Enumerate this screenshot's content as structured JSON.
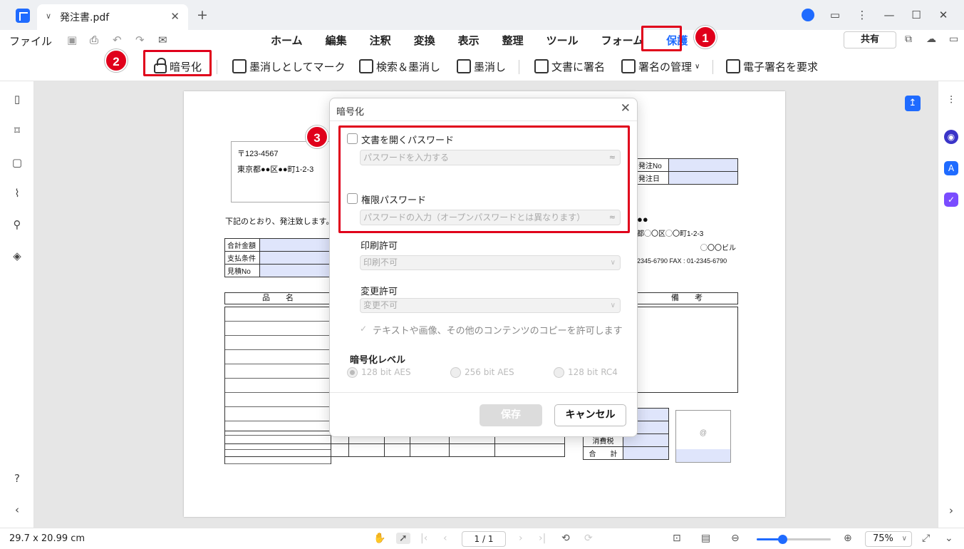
{
  "window": {
    "tab_title": "発注書.pdf",
    "new_tab": "+",
    "controls": [
      "⋮",
      "—",
      "☐",
      "✕"
    ]
  },
  "menubar": {
    "file": "ファイル",
    "items": [
      "ホーム",
      "編集",
      "注釈",
      "変換",
      "表示",
      "整理",
      "ツール",
      "フォーム",
      "保護"
    ],
    "active": "保護",
    "share": "共有"
  },
  "toolbar": {
    "encrypt": "暗号化",
    "mark_redact": "墨消しとしてマーク",
    "search_redact": "検索＆墨消し",
    "redact": "墨消し",
    "sign_doc": "文書に署名",
    "manage_sig": "署名の管理",
    "request_esig": "電子署名を要求"
  },
  "badges": [
    "1",
    "2",
    "3"
  ],
  "document": {
    "postal": "〒123-4567",
    "address": "東京都●●区●●町1-2-3",
    "intro": "下記のとおり、発注致します。",
    "left_fields": [
      "合計金額",
      "支払条件",
      "見積No"
    ],
    "right_fields": [
      "発注No",
      "発注日"
    ],
    "sender_line1": "●●",
    "sender_addr": "都◯〇区◯〇町1-2-3",
    "sender_bldg": "◯〇〇ビル",
    "sender_tel": "2345-6790  FAX : 01-2345-6790",
    "col_item": "品　　名",
    "col_note": "備　　考",
    "tax_label": "消費税",
    "total_label": "合　　計",
    "stamp": "@"
  },
  "dialog": {
    "title": "暗号化",
    "open_pw_label": "文書を開くパスワード",
    "open_pw_placeholder": "パスワードを入力する",
    "perm_pw_label": "権限パスワード",
    "perm_pw_placeholder": "パスワードの入力（オープンパスワードとは異なります）",
    "print_label": "印刷許可",
    "print_value": "印刷不可",
    "change_label": "変更許可",
    "change_value": "変更不可",
    "copy_label": "テキストや画像、その他のコンテンツのコピーを許可します",
    "level_label": "暗号化レベル",
    "levels": [
      "128 bit AES",
      "256 bit AES",
      "128 bit RC4"
    ],
    "save": "保存",
    "cancel": "キャンセル"
  },
  "statusbar": {
    "dims": "29.7 x 20.99 cm",
    "page": "1 / 1",
    "zoom": "75%",
    "zoom_fraction": 0.35
  },
  "colors": {
    "accent": "#1f6bff",
    "highlight": "#e0001b"
  }
}
